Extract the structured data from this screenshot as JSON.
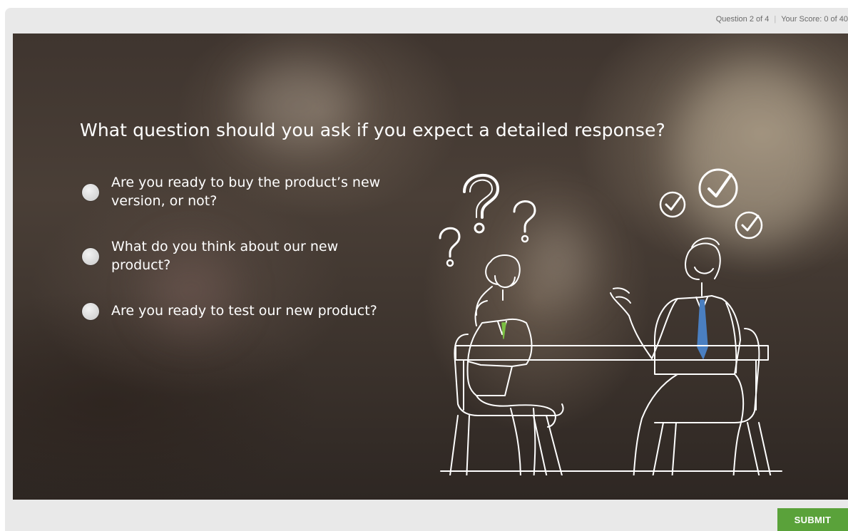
{
  "header": {
    "question_progress": "Question 2 of 4",
    "separator": "|",
    "score": "Your Score: 0 of 40"
  },
  "slide": {
    "question": "What question should you ask if you expect a detailed response?",
    "answers": [
      {
        "label": "Are you ready to buy the product’s new version, or not?"
      },
      {
        "label": "What do you think about our new product?"
      },
      {
        "label": "Are you ready to test our new product?"
      }
    ],
    "illustration": {
      "question-mark-icons": 3,
      "checkmark-icons": 3
    }
  },
  "footer": {
    "submit_label": "SUBMIT"
  },
  "colors": {
    "submit": "#5aa23a",
    "woman_tie": "#7bc043",
    "man_tie": "#4a7fc1",
    "line_art": "#ffffff"
  }
}
